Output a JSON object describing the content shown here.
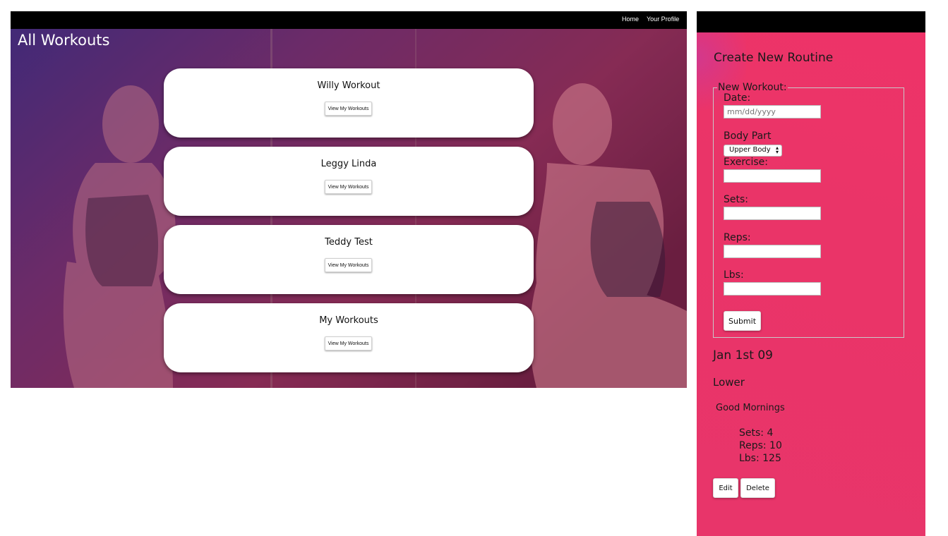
{
  "nav": {
    "home": "Home",
    "profile": "Your Profile"
  },
  "main": {
    "title": "All Workouts",
    "cards": [
      {
        "title": "Willy Workout",
        "button": "View My Workouts"
      },
      {
        "title": "Leggy Linda",
        "button": "View My Workouts"
      },
      {
        "title": "Teddy Test",
        "button": "View My Workouts"
      },
      {
        "title": "My Workouts",
        "button": "View My Workouts"
      }
    ]
  },
  "routine": {
    "title": "Create New Routine",
    "legend": "New Workout:",
    "date_label": "Date:",
    "date_placeholder": "mm/dd/yyyy",
    "bodypart_label": "Body Part",
    "bodypart_selected": "Upper Body",
    "exercise_label": "Exercise:",
    "sets_label": "Sets:",
    "reps_label": "Reps:",
    "lbs_label": "Lbs:",
    "submit": "Submit"
  },
  "entry": {
    "date": "Jan 1st 09",
    "category": "Lower",
    "exercise": "Good Mornings",
    "sets": "Sets: 4",
    "reps": "Reps: 10",
    "lbs": "Lbs: 125",
    "edit": "Edit",
    "delete": "Delete"
  },
  "colors": {
    "panel": "#ea3468",
    "nav": "#000000",
    "overlay": "#7a2d5e"
  }
}
